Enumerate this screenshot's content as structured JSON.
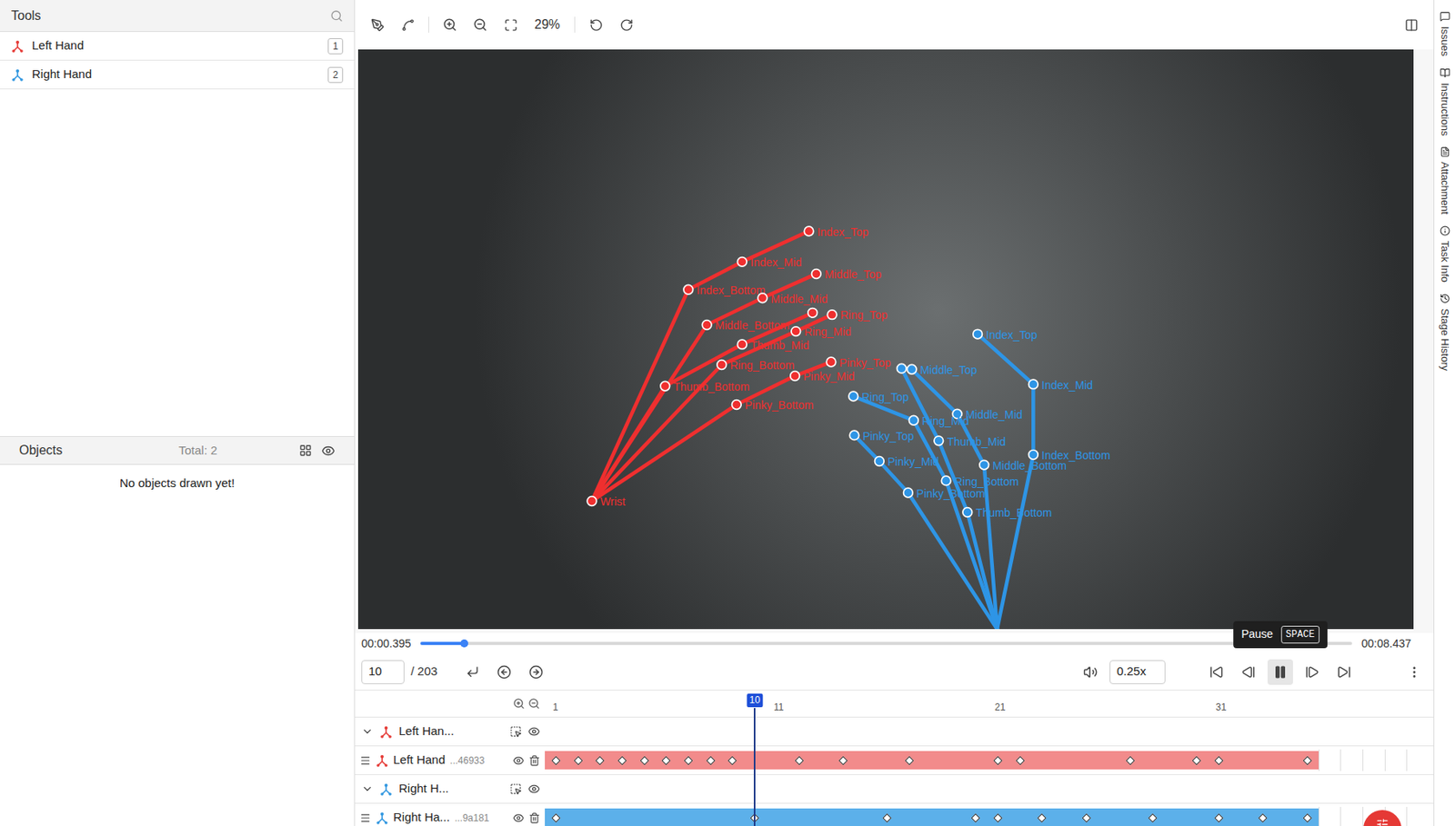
{
  "tools": {
    "title": "Tools",
    "items": [
      {
        "label": "Left Hand",
        "hotkey": "1",
        "color": "#e53935"
      },
      {
        "label": "Right Hand",
        "hotkey": "2",
        "color": "#2f96e0"
      }
    ]
  },
  "objects": {
    "title": "Objects",
    "total": "Total: 2",
    "empty": "No objects drawn yet!"
  },
  "toolbar": {
    "zoom": "29%"
  },
  "hands": [
    {
      "name": "Left Hand",
      "color": "#ef2f2f",
      "points": [
        "Wrist",
        "Thumb_Bottom",
        "Thumb_Mid",
        "Index_Bottom",
        "Index_Mid",
        "Index_Top",
        "Middle_Bottom",
        "Middle_Mid",
        "Middle_Top",
        "Ring_Bottom",
        "Ring_Mid",
        "Ring_Top",
        "Pinky_Bottom",
        "Pinky_Mid",
        "Pinky_Top"
      ]
    },
    {
      "name": "Right Hand",
      "color": "#2e95e6",
      "points": [
        "Thumb_Bottom",
        "Thumb_Mid",
        "Index_Bottom",
        "Index_Mid",
        "Index_Top",
        "Middle_Bottom",
        "Middle_Mid",
        "Middle_Top",
        "Ring_Bottom",
        "Ring_Mid",
        "Ring_Top",
        "Pinky_Bottom",
        "Pinky_Mid",
        "Pinky_Top"
      ]
    }
  ],
  "player": {
    "current_time": "00:00.395",
    "total_time": "00:08.437",
    "level": 0.047,
    "frame": "10",
    "frame_total": "/ 203",
    "speed": "0.25x",
    "tooltip": {
      "label": "Pause",
      "key": "SPACE"
    }
  },
  "timeline": {
    "current_frame": "10",
    "ruler": [
      "1",
      "11",
      "21",
      "31"
    ],
    "groups": [
      {
        "label": "Left Han...",
        "expanded": true,
        "icon_color": "#e53935",
        "track": {
          "label": "Left Hand",
          "id": "...46933",
          "frames": 35,
          "color": "#f28b8b",
          "keyframes": [
            1,
            2,
            3,
            4,
            5,
            6,
            7,
            8,
            9,
            12,
            14,
            17,
            21,
            22,
            27,
            30,
            31,
            35
          ]
        }
      },
      {
        "label": "Right H...",
        "expanded": true,
        "icon_color": "#2f96e0",
        "track": {
          "label": "Right Ha...",
          "id": "...9a181",
          "frames": 35,
          "color": "#5cb0ea",
          "keyframes": [
            1,
            10,
            16,
            20,
            21,
            23,
            25,
            28,
            31,
            33,
            35
          ]
        }
      }
    ]
  },
  "side_tabs": [
    "Issues",
    "Instructions",
    "Attachment",
    "Task Info",
    "Stage History"
  ]
}
